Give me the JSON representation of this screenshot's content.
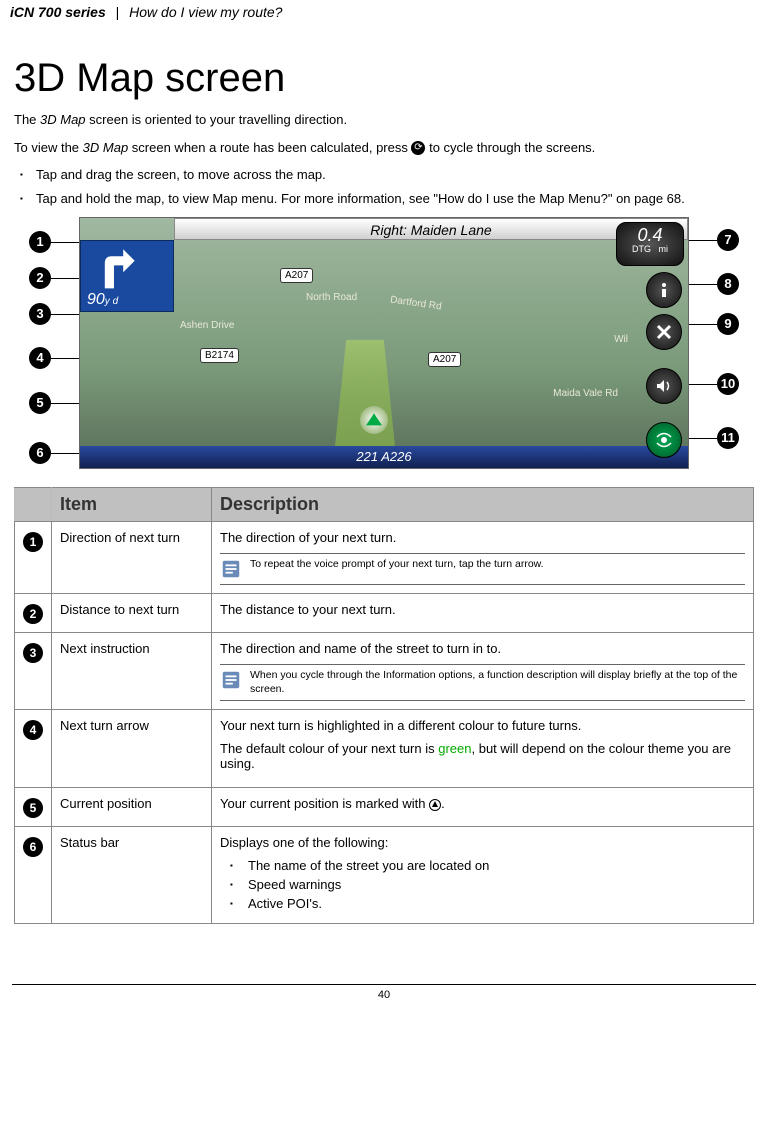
{
  "header": {
    "series": "iCN 700 series",
    "separator": "|",
    "breadcrumb": "How do I view my route?"
  },
  "title": "3D Map screen",
  "intro1_a": "The ",
  "intro1_b": "3D Map",
  "intro1_c": " screen is oriented to your travelling direction.",
  "intro2_a": "To view the ",
  "intro2_b": "3D Map",
  "intro2_c": " screen when a route has been calculated, press ",
  "intro2_d": " to cycle through the screens.",
  "bullets": [
    "Tap and drag the screen, to move across the map.",
    "Tap and hold the map, to view Map menu. For more information, see \"How do I use the Map Menu?\" on page 68."
  ],
  "callouts_left": [
    "1",
    "2",
    "3",
    "4",
    "5",
    "6"
  ],
  "callouts_right": [
    "7",
    "8",
    "9",
    "10",
    "11"
  ],
  "map": {
    "next_instruction": "Right: Maiden Lane",
    "turn_distance": "90",
    "turn_unit": "y d",
    "shield1": "A207",
    "shield2": "B2174",
    "street1": "Ashen Drive",
    "street2": "North Road",
    "street3": "Dartford Rd",
    "street4": "Maida Vale Rd",
    "street5": "A207",
    "street6": "Wil",
    "status": "221 A226",
    "dtg_value": "0.4",
    "dtg_label": "DTG",
    "dtg_unit": "mi"
  },
  "table": {
    "col1": "Item",
    "col2": "Description",
    "rows": [
      {
        "num": "1",
        "item": "Direction of next turn",
        "desc": "The direction of your next turn.",
        "note": "To repeat the voice prompt of your next turn, tap the turn arrow."
      },
      {
        "num": "2",
        "item": "Distance to next turn",
        "desc": "The distance to your next turn."
      },
      {
        "num": "3",
        "item": "Next instruction",
        "desc": "The direction and name of the street to turn in to.",
        "note": "When you cycle through the Information options, a function description will display briefly at the top of the screen."
      },
      {
        "num": "4",
        "item": "Next turn arrow",
        "desc_a": "Your next turn is highlighted in a different colour to future turns.",
        "desc_b": "The default colour of your next turn is ",
        "desc_green": "green",
        "desc_c": ", but will depend on the colour theme you are using."
      },
      {
        "num": "5",
        "item": "Current position",
        "desc_a": "Your current position is marked with ",
        "desc_b": "."
      },
      {
        "num": "6",
        "item": "Status bar",
        "desc": "Displays one of the following:",
        "sub": [
          "The name of the street you are located on",
          "Speed warnings",
          "Active POI's."
        ]
      }
    ]
  },
  "page_number": "40"
}
